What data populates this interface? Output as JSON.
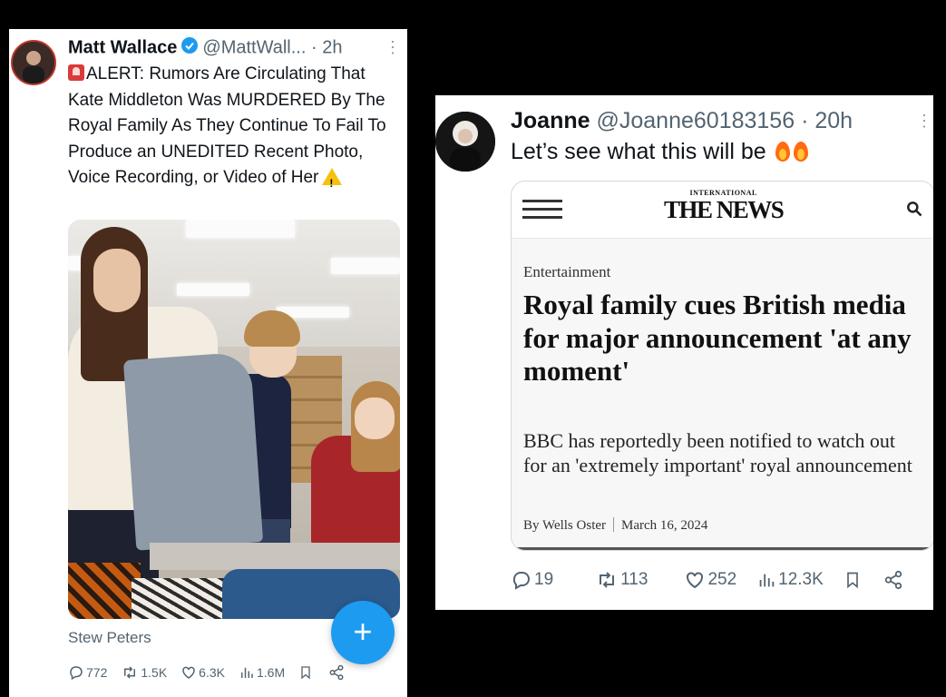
{
  "left_tweet": {
    "name": "Matt Wallace",
    "handle": "@MattWall...",
    "time": "· 2h",
    "text": "ALERT: Rumors Are Circulating That Kate Middleton Was MURDERED By The Royal Family As They Continue To Fail To Produce an UNEDITED Recent Photo, Voice Recording, or Video of Her",
    "source": "Stew Peters",
    "fab_label": "+",
    "stats": {
      "replies": "772",
      "reposts": "1.5K",
      "likes": "6.3K",
      "views": "1.6M"
    },
    "icons": [
      "verified-badge-icon",
      "alert-siren-icon",
      "warning-icon",
      "more-icon",
      "reply-icon",
      "repost-icon",
      "like-icon",
      "views-icon",
      "bookmark-icon",
      "share-icon"
    ]
  },
  "right_tweet": {
    "name": "Joanne",
    "handle": "@Joanne60183156",
    "time": "· 20h",
    "text": "Let’s see what this will be",
    "card": {
      "masthead_small": "INTERNATIONAL",
      "masthead": "THE NEWS",
      "category": "Entertainment",
      "headline": "Royal family cues British media for major announcement 'at any moment'",
      "summary": "BBC has reportedly been notified to watch out for an 'extremely important' royal announcement",
      "author": "By Wells Oster",
      "date": "March 16, 2024"
    },
    "stats": {
      "replies": "19",
      "reposts": "113",
      "likes": "252",
      "views": "12.3K"
    },
    "icons": [
      "fire-icon",
      "menu-icon",
      "search-icon",
      "reply-icon",
      "repost-icon",
      "like-icon",
      "views-icon",
      "bookmark-icon",
      "share-icon"
    ]
  },
  "colors": {
    "accent": "#1d9bf0",
    "muted": "#536471",
    "background": "#000000"
  }
}
